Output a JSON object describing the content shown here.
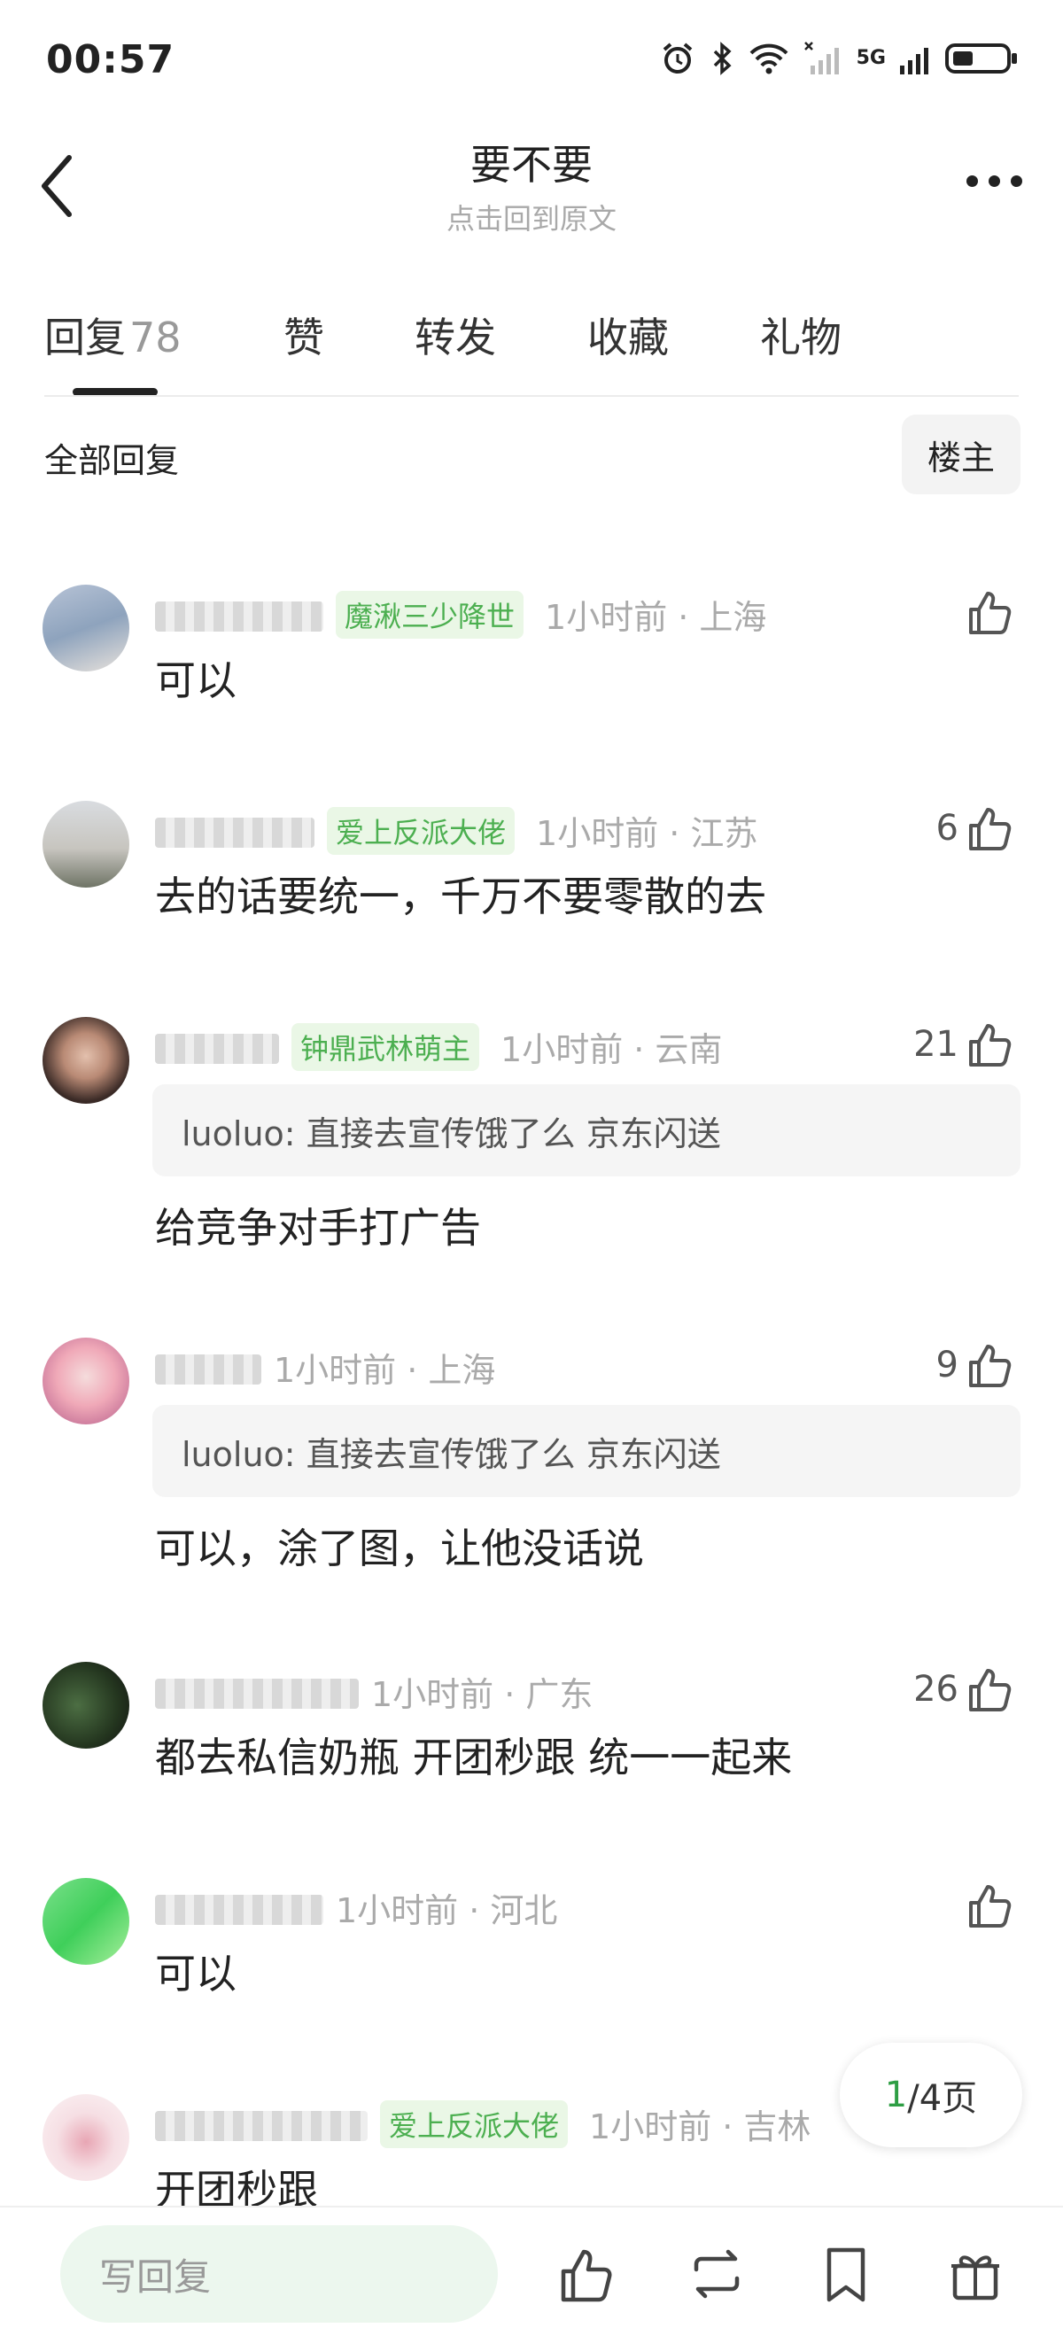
{
  "status_bar": {
    "time": "00:57",
    "network": "5G"
  },
  "header": {
    "title": "要不要",
    "subtitle": "点击回到原文"
  },
  "tabs": [
    {
      "label": "回复",
      "count": "78"
    },
    {
      "label": "赞"
    },
    {
      "label": "转发"
    },
    {
      "label": "收藏"
    },
    {
      "label": "礼物"
    }
  ],
  "filter": {
    "all_label": "全部回复",
    "owner_label": "楼主"
  },
  "comments": [
    {
      "badge": "魔湫三少降世",
      "time": "1小时前 · 上海",
      "likes": "",
      "content": "可以"
    },
    {
      "badge": "爱上反派大佬",
      "time": "1小时前 · 江苏",
      "likes": "6",
      "content": "去的话要统一，千万不要零散的去"
    },
    {
      "badge": "钟鼎武林萌主",
      "time": "1小时前 · 云南",
      "likes": "21",
      "quote": "luoluo: 直接去宣传饿了么 京东闪送",
      "content": "给竞争对手打广告"
    },
    {
      "badge": "",
      "time": "1小时前 · 上海",
      "likes": "9",
      "quote": "luoluo: 直接去宣传饿了么 京东闪送",
      "content": "可以，涂了图，让他没话说"
    },
    {
      "badge": "",
      "time": "1小时前 · 广东",
      "likes": "26",
      "content": "都去私信奶瓶 开团秒跟 统一一起来"
    },
    {
      "badge": "",
      "time": "1小时前 · 河北",
      "likes": "",
      "content": "可以"
    },
    {
      "badge": "爱上反派大佬",
      "time": "1小时前 · 吉林",
      "likes": "",
      "content": "开团秒跟"
    }
  ],
  "pager": {
    "current": "1",
    "total_label": "/4页"
  },
  "bottom_bar": {
    "reply_placeholder": "写回复"
  },
  "colors": {
    "accent_green": "#4caf50",
    "badge_bg": "#eaf7e6",
    "input_bg": "#ecf7ee"
  }
}
